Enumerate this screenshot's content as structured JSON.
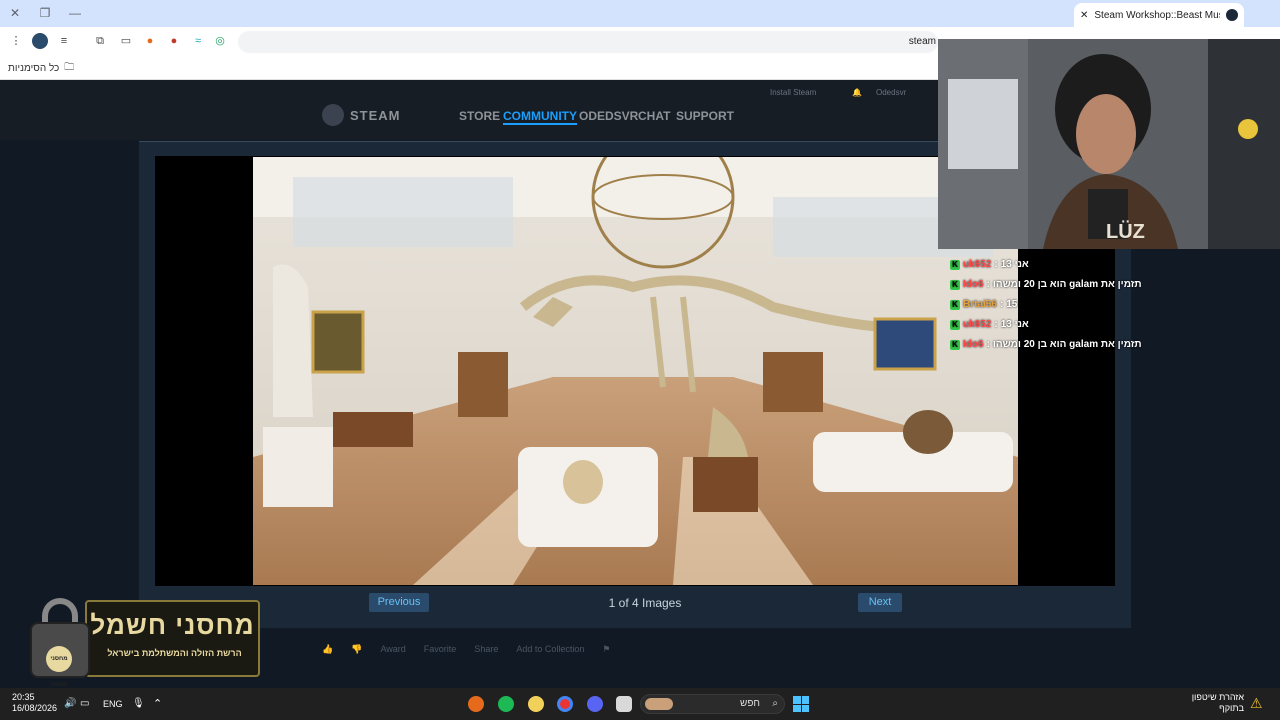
{
  "browser": {
    "tab_title": "Steam Workshop::Beast Museum",
    "url": "steam",
    "bookmarks_label": "כל הסימניות"
  },
  "steam": {
    "logo_text": "STEAM",
    "nav": [
      "STORE",
      "COMMUNITY",
      "ODEDSVR",
      "CHAT",
      "SUPPORT"
    ],
    "install_label": "Install Steam",
    "account_name": "Odedsvr"
  },
  "viewer": {
    "previous_label": "Previous",
    "next_label": "Next",
    "counter": "1 of 4 Images"
  },
  "actions": [
    "Award",
    "Favorite",
    "Share",
    "Add to Collection"
  ],
  "chat": [
    {
      "user": "uk652",
      "message": "אני 13",
      "color": "red"
    },
    {
      "user": "Ido6",
      "message": "הוא בן 20 ומשהו galam תזמין את",
      "color": "red"
    },
    {
      "user": "Brtai56",
      "message": "15",
      "color": "orange"
    },
    {
      "user": "uk652",
      "message": "אני 13",
      "color": "red"
    },
    {
      "user": "Ido6",
      "message": "הוא בן 20 ומשהו galam תזמין את",
      "color": "red"
    }
  ],
  "brand": {
    "title": "מחסני חשמל",
    "subtitle": "הרשת הזולה והמשתלמת בישראל",
    "badge": "מחסני חשמל"
  },
  "webcam": {
    "shirt_text": "LÜZ"
  },
  "taskbar": {
    "time": "20:35",
    "date": "16/08/2026",
    "lang": "ENG",
    "search_placeholder": "חפש",
    "warning_line1": "אזהרת שיטפון",
    "warning_line2": "בתוקף"
  },
  "colors": {
    "steam_blue": "#1a9fff",
    "button_bg": "#2a4b6b",
    "button_text": "#67c1f5"
  }
}
